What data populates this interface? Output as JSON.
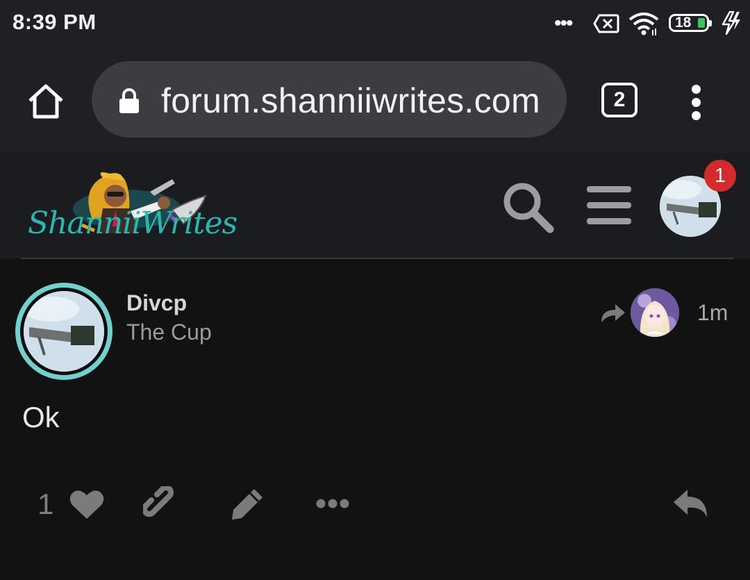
{
  "status_bar": {
    "time": "8:39 PM",
    "battery_level": "18",
    "icons": [
      "more-dots-icon",
      "no-sim-icon",
      "wifi-icon",
      "battery-icon",
      "charging-bolt-icon"
    ]
  },
  "browser": {
    "url": "forum.shanniiwrites.com",
    "tab_count": "2"
  },
  "site": {
    "logo_text": "ShanniiWrites",
    "notification_count": "1",
    "colors": {
      "logo_teal": "#27b8b0",
      "badge_red": "#d32a2a",
      "ring_cyan": "#71d1cc"
    }
  },
  "post": {
    "username": "Divcp",
    "user_title": "The Cup",
    "time_ago": "1m",
    "body": "Ok",
    "like_count": "1"
  }
}
